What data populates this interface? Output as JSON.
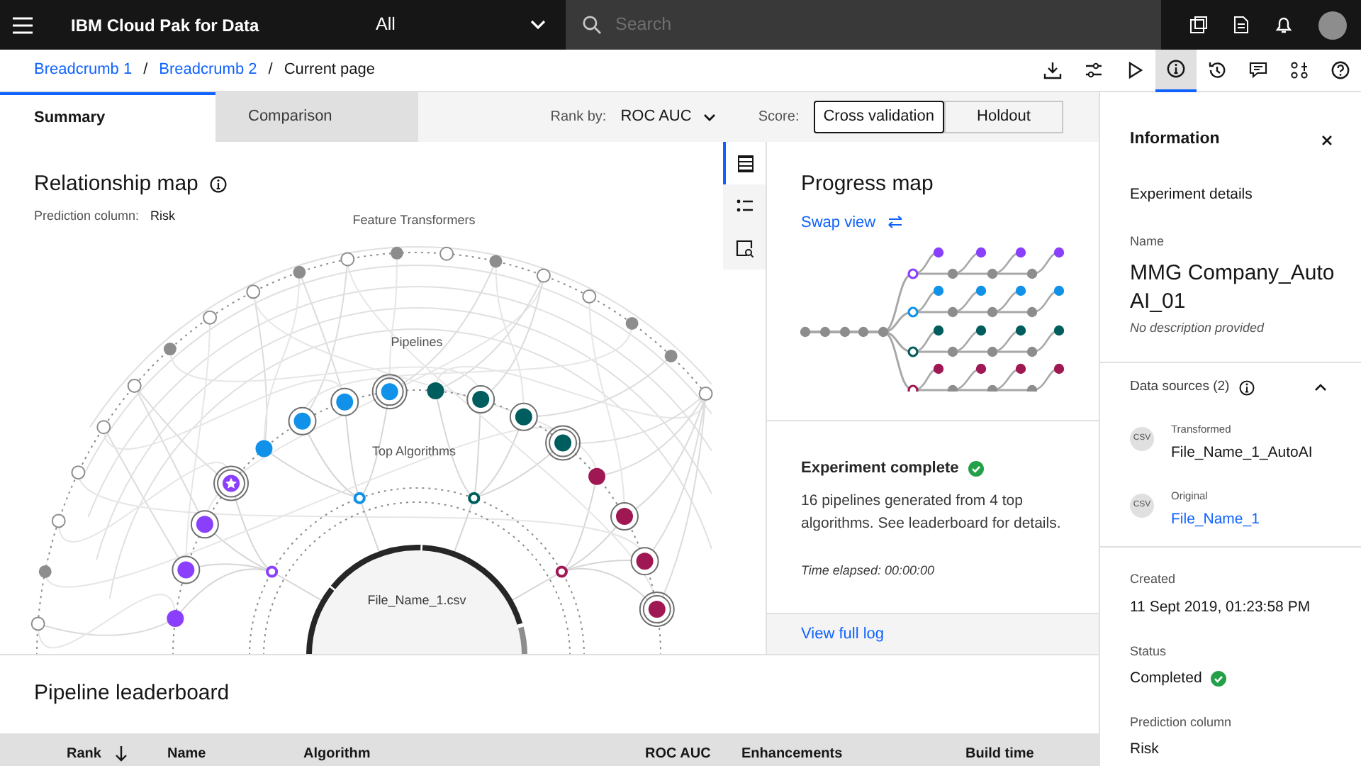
{
  "header": {
    "product": "IBM Cloud Pak for Data",
    "scope": "All",
    "search": {
      "placeholder": "Search"
    }
  },
  "breadcrumb": [
    {
      "label": "Breadcrumb 1",
      "link": true
    },
    {
      "label": "Breadcrumb 2",
      "link": true,
      "separator": "/"
    },
    {
      "label": "Current page",
      "link": false,
      "separator": "/"
    }
  ],
  "toolbar": [
    {
      "kind": "download",
      "selected": false
    },
    {
      "kind": "sliders",
      "selected": false
    },
    {
      "kind": "play",
      "selected": false
    },
    {
      "kind": "info",
      "selected": true
    },
    {
      "kind": "history",
      "selected": false
    },
    {
      "kind": "comment",
      "selected": false
    },
    {
      "kind": "nodes",
      "selected": false
    },
    {
      "kind": "help",
      "selected": false
    }
  ],
  "tabs": [
    {
      "label": "Summary",
      "selected": true
    },
    {
      "label": "Comparison",
      "selected": false
    }
  ],
  "rank_by": {
    "label": "Rank by:",
    "value": "ROC AUC"
  },
  "score": {
    "label": "Score:",
    "options": [
      {
        "label": "Cross validation",
        "selected": true
      },
      {
        "label": "Holdout",
        "selected": false
      }
    ]
  },
  "relationship_map": {
    "title": "Relationship map",
    "prediction_label": "Prediction column:",
    "prediction_value": "Risk",
    "ring_labels": [
      "Feature Transformers",
      "Pipelines",
      "Top Algorithms"
    ],
    "center_label": "File_Name_1.csv",
    "views": [
      {
        "kind": "list",
        "selected": true
      },
      {
        "kind": "bullets",
        "selected": false
      },
      {
        "kind": "inspect",
        "selected": false
      }
    ]
  },
  "progress_map": {
    "title": "Progress map",
    "swap_link": "Swap view",
    "status_title": "Experiment complete",
    "status_text": "16 pipelines generated from 4 top algorithms. See leaderboard for details.",
    "time": "Time elapsed: 00:00:00",
    "log_link": "View full log"
  },
  "info_panel": {
    "title": "Information",
    "section": "Experiment details",
    "name_label": "Name",
    "name": "MMG Company_AutoAI_01",
    "description": "No description provided",
    "data_sources": {
      "title": "Data sources (2)",
      "expanded": true,
      "items": [
        {
          "badge": "CSV",
          "label": "Transformed",
          "name": "File_Name_1_AutoAI",
          "link": false
        },
        {
          "badge": "CSV",
          "label": "Original",
          "name": "File_Name_1",
          "link": true
        }
      ]
    },
    "fields": [
      {
        "label": "Created",
        "value": "11 Sept 2019, 01:23:58 PM",
        "kind": "text"
      },
      {
        "label": "Status",
        "value": "Completed",
        "kind": "status"
      },
      {
        "label": "Prediction column",
        "value": "Risk",
        "kind": "text"
      }
    ]
  },
  "leaderboard": {
    "title": "Pipeline leaderboard",
    "columns": [
      {
        "label": "Rank",
        "sorted": true
      },
      {
        "label": "Name",
        "sorted": false
      },
      {
        "label": "Algorithm",
        "sorted": false
      },
      {
        "label": "ROC AUC",
        "sorted": false
      },
      {
        "label": "Enhancements",
        "sorted": false
      },
      {
        "label": "Build time",
        "sorted": false
      }
    ]
  }
}
